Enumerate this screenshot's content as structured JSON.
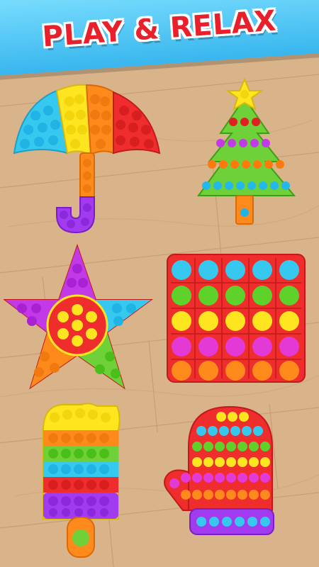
{
  "header": {
    "title": "PLAY & RELAX"
  },
  "colors": {
    "wood": "#d9b48a",
    "wood_dark": "#c49a6c",
    "header_blue": "#38b6ee",
    "title_red": "#e8202b",
    "pop_red": "#ef2d2d",
    "pop_orange": "#ff8a1c",
    "pop_yellow": "#ffe51f",
    "pop_green": "#5fd12b",
    "pop_cyan": "#36c8ee",
    "pop_blue": "#2aa4ff",
    "pop_purple": "#a23bf0",
    "pop_magenta": "#e33ad6"
  },
  "toys": [
    {
      "id": "umbrella",
      "icon": "umbrella-pop-it-icon"
    },
    {
      "id": "christmas-tree",
      "icon": "christmas-tree-pop-it-icon"
    },
    {
      "id": "star",
      "icon": "star-pop-it-icon"
    },
    {
      "id": "square",
      "icon": "square-pop-it-icon"
    },
    {
      "id": "popsicle",
      "icon": "popsicle-pop-it-icon"
    },
    {
      "id": "mitten",
      "icon": "mitten-pop-it-icon"
    }
  ]
}
